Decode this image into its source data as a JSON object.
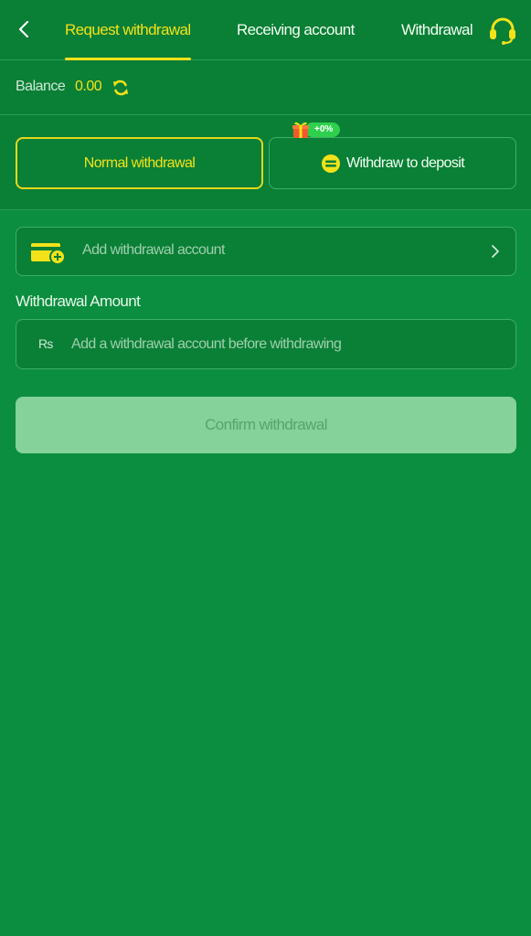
{
  "header": {
    "back_icon": "chevron-left-icon",
    "tabs": [
      {
        "label": "Request withdrawal",
        "active": true
      },
      {
        "label": "Receiving account",
        "active": false
      },
      {
        "label": "Withdrawal",
        "active": false
      }
    ],
    "support_icon": "headset-icon"
  },
  "balance": {
    "label": "Balance",
    "value": "0.00",
    "refresh_icon": "refresh-icon"
  },
  "methods": {
    "normal_label": "Normal withdrawal",
    "deposit_label": "Withdraw to deposit",
    "promo_badge": "+0%",
    "selected": "normal"
  },
  "form": {
    "account_label": "Add withdrawal account",
    "amount_label": "Withdrawal Amount",
    "currency_symbol": "₨",
    "amount_placeholder": "Add a withdrawal account before withdrawing",
    "amount_value": ""
  },
  "confirm_button": {
    "label": "Confirm withdrawal",
    "enabled": false
  },
  "colors": {
    "background": "#0b8e3f",
    "panel": "#0a7f36",
    "accent": "#f3e21a",
    "border": "#3fae66",
    "disabled_button": "#85d29b"
  }
}
